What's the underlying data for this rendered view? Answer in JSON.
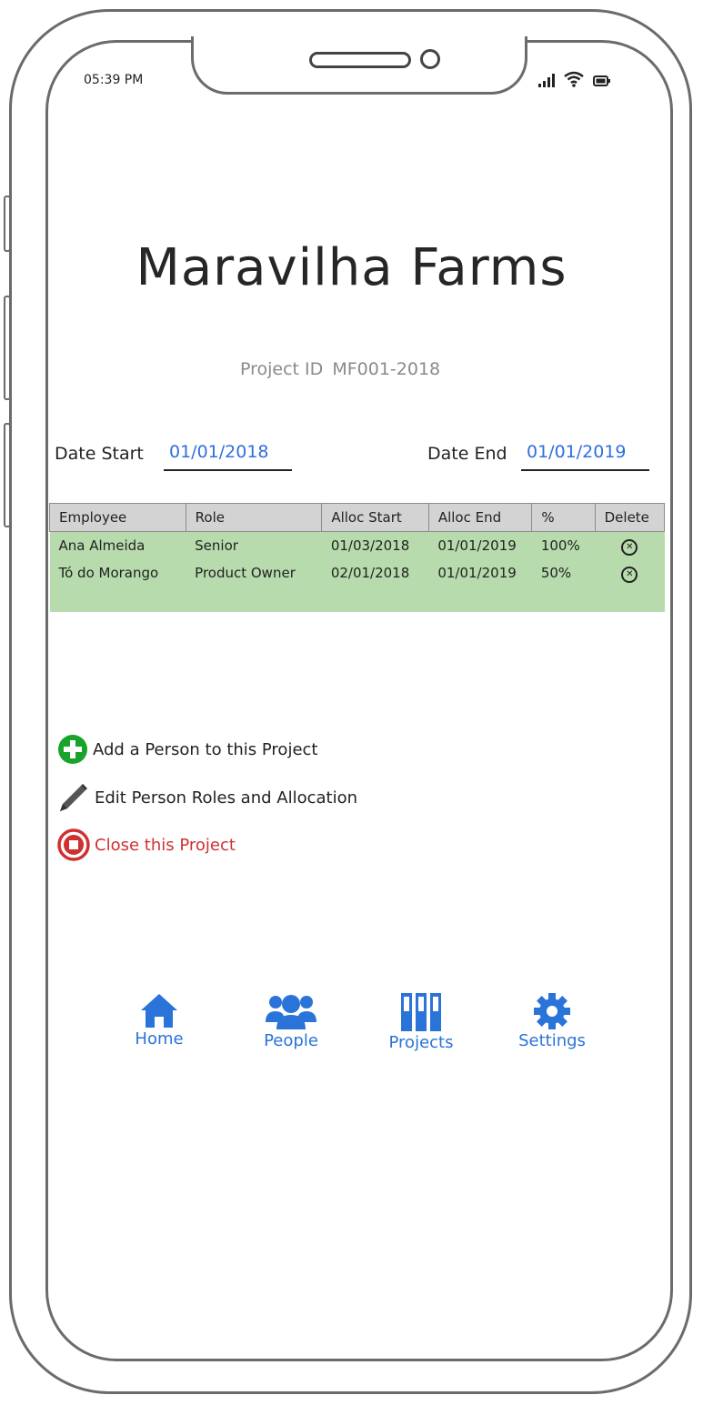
{
  "status_bar": {
    "time": "05:39 PM",
    "icons": [
      "signal-icon",
      "wifi-icon",
      "battery-icon"
    ]
  },
  "header": {
    "title": "Maravilha Farms",
    "project_id_label": "Project ID",
    "project_id_value": "MF001-2018"
  },
  "dates": {
    "start_label": "Date Start",
    "start_value": "01/01/2018",
    "end_label": "Date End",
    "end_value": "01/01/2019"
  },
  "table": {
    "columns": [
      "Employee",
      "Role",
      "Alloc Start",
      "Alloc End",
      "%",
      "Delete"
    ],
    "rows": [
      {
        "employee": "Ana Almeida",
        "role": "Senior",
        "alloc_start": "01/03/2018",
        "alloc_end": "01/01/2019",
        "percent": "100%"
      },
      {
        "employee": "Tó do Morango",
        "role": "Product Owner",
        "alloc_start": "02/01/2018",
        "alloc_end": "01/01/2019",
        "percent": "50%"
      }
    ]
  },
  "actions": {
    "add_person": "Add a Person to this Project",
    "edit_roles": "Edit Person Roles and Allocation",
    "close_project": "Close this Project"
  },
  "tabs": [
    {
      "label": "Home",
      "icon": "home-icon"
    },
    {
      "label": "People",
      "icon": "people-icon"
    },
    {
      "label": "Projects",
      "icon": "projects-icon"
    },
    {
      "label": "Settings",
      "icon": "gear-icon"
    }
  ],
  "colors": {
    "accent": "#2a73d8",
    "table_row_bg": "#b7dbac",
    "table_header_bg": "#d3d3d3",
    "danger": "#d03030",
    "add_green": "#1aa32a",
    "link_blue": "#2f6fde"
  }
}
